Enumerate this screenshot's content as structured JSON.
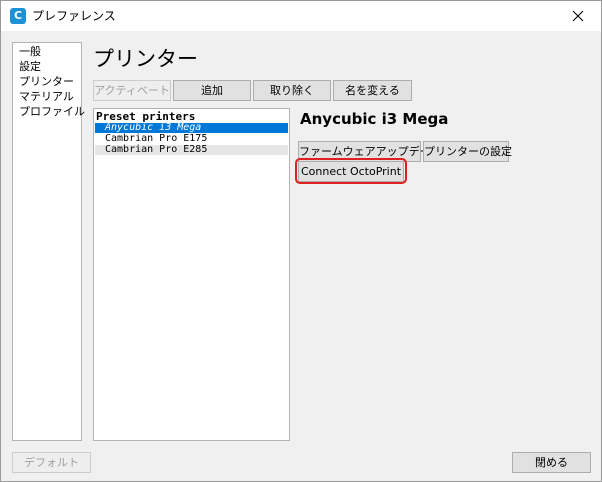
{
  "window": {
    "title": "プレファレンス",
    "icon": "C"
  },
  "sidebar": {
    "items": [
      {
        "label": "一般"
      },
      {
        "label": "設定"
      },
      {
        "label": "プリンター"
      },
      {
        "label": "マテリアル"
      },
      {
        "label": "プロファイル"
      }
    ]
  },
  "main": {
    "title": "プリンター",
    "toolbar": {
      "activate_label": "アクティベート",
      "add_label": "追加",
      "remove_label": "取り除く",
      "rename_label": "名を変える"
    },
    "printer_list": {
      "group_header": "Preset printers",
      "items": [
        {
          "label": "Anycubic i3 Mega"
        },
        {
          "label": "Cambrian Pro E175"
        },
        {
          "label": "Cambrian Pro E285"
        }
      ]
    },
    "selected_printer": {
      "name": "Anycubic i3 Mega",
      "firmware_update_label": "ファームウェアアップデート",
      "printer_settings_label": "プリンターの設定",
      "connect_octoprint_label": "Connect OctoPrint"
    }
  },
  "footer": {
    "defaults_label": "デフォルト",
    "close_label": "閉める"
  },
  "colors": {
    "selection": "#0078d7",
    "highlight": "#e02020",
    "app_icon": "#1e90d6"
  }
}
